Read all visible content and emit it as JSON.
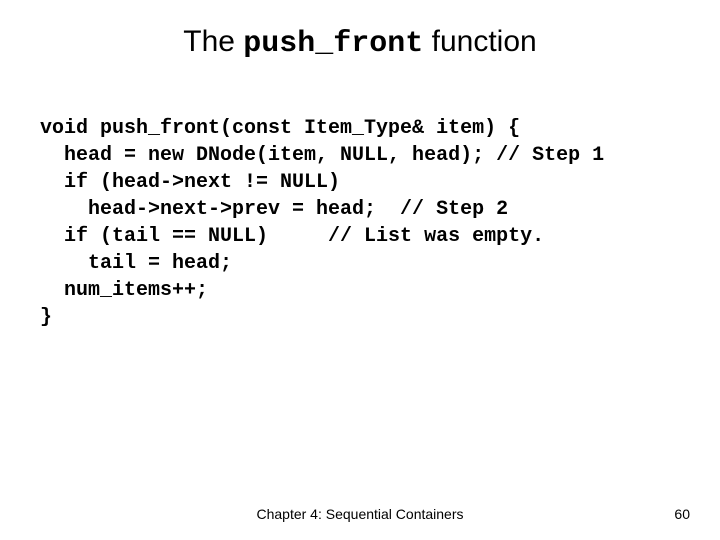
{
  "title": {
    "prefix": "The ",
    "mono": "push_front",
    "suffix": " function"
  },
  "code": "void push_front(const Item_Type& item) {\n  head = new DNode(item, NULL, head); // Step 1\n  if (head->next != NULL)\n    head->next->prev = head;  // Step 2\n  if (tail == NULL)     // List was empty.\n    tail = head;\n  num_items++;\n}",
  "footer": {
    "chapter": "Chapter 4: Sequential Containers",
    "page": "60"
  }
}
